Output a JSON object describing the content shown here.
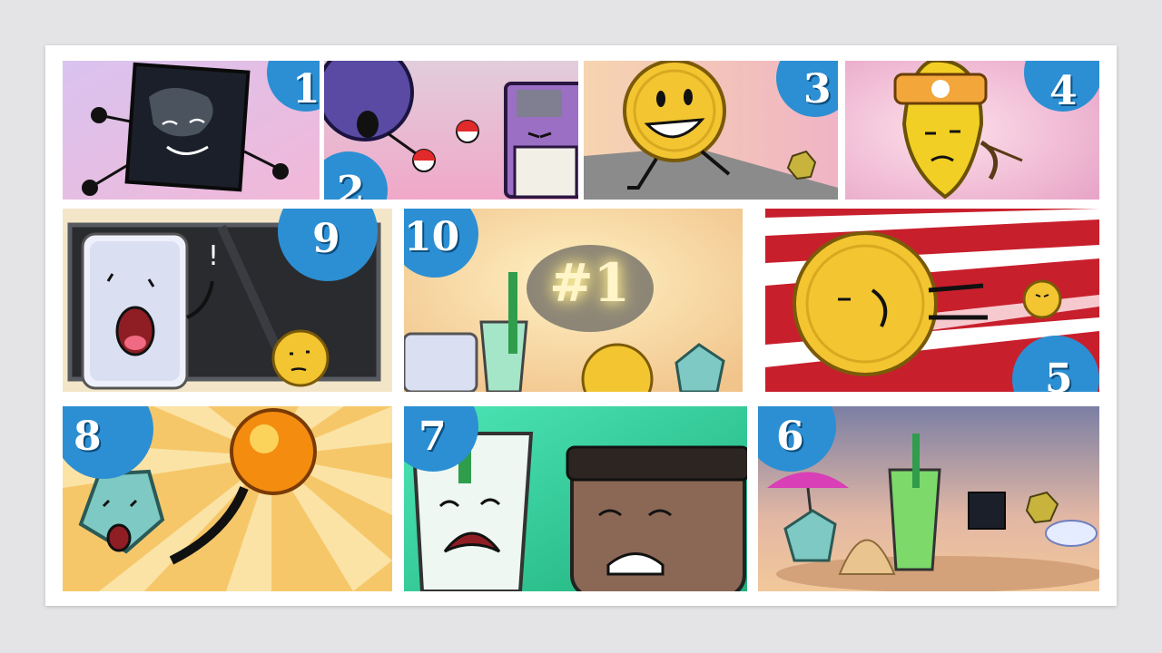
{
  "colors": {
    "page_background": "#e4e4e6",
    "sheet": "#ffffff",
    "badge": "#2c8fd3",
    "badge_text": "#ffffff"
  },
  "panels": [
    {
      "number": "1",
      "character": "black-square-character",
      "scene": "lavender-sky"
    },
    {
      "number": "2",
      "character": "purple-ball-and-floppy-disk",
      "scene": "pink-gradient"
    },
    {
      "number": "3",
      "character": "coin-character-running",
      "scene": "orange-sky"
    },
    {
      "number": "4",
      "character": "yellow-leaf-with-bow",
      "scene": "pink-radial"
    },
    {
      "number": "9",
      "character": "card-character-at-chalkboard",
      "scene": "chalkboard"
    },
    {
      "number": "10",
      "character": "glowing-number-one-trophy",
      "scene": "golden-glow"
    },
    {
      "number": "5",
      "character": "coin-character-dashing",
      "scene": "red-speed-lines"
    },
    {
      "number": "8",
      "character": "pentagon-with-orange-ball",
      "scene": "sunburst"
    },
    {
      "number": "7",
      "character": "cup-and-jar-characters",
      "scene": "green-gradient"
    },
    {
      "number": "6",
      "character": "group-on-beach",
      "scene": "desert-dusk"
    }
  ],
  "panel_10_sign": "#1"
}
